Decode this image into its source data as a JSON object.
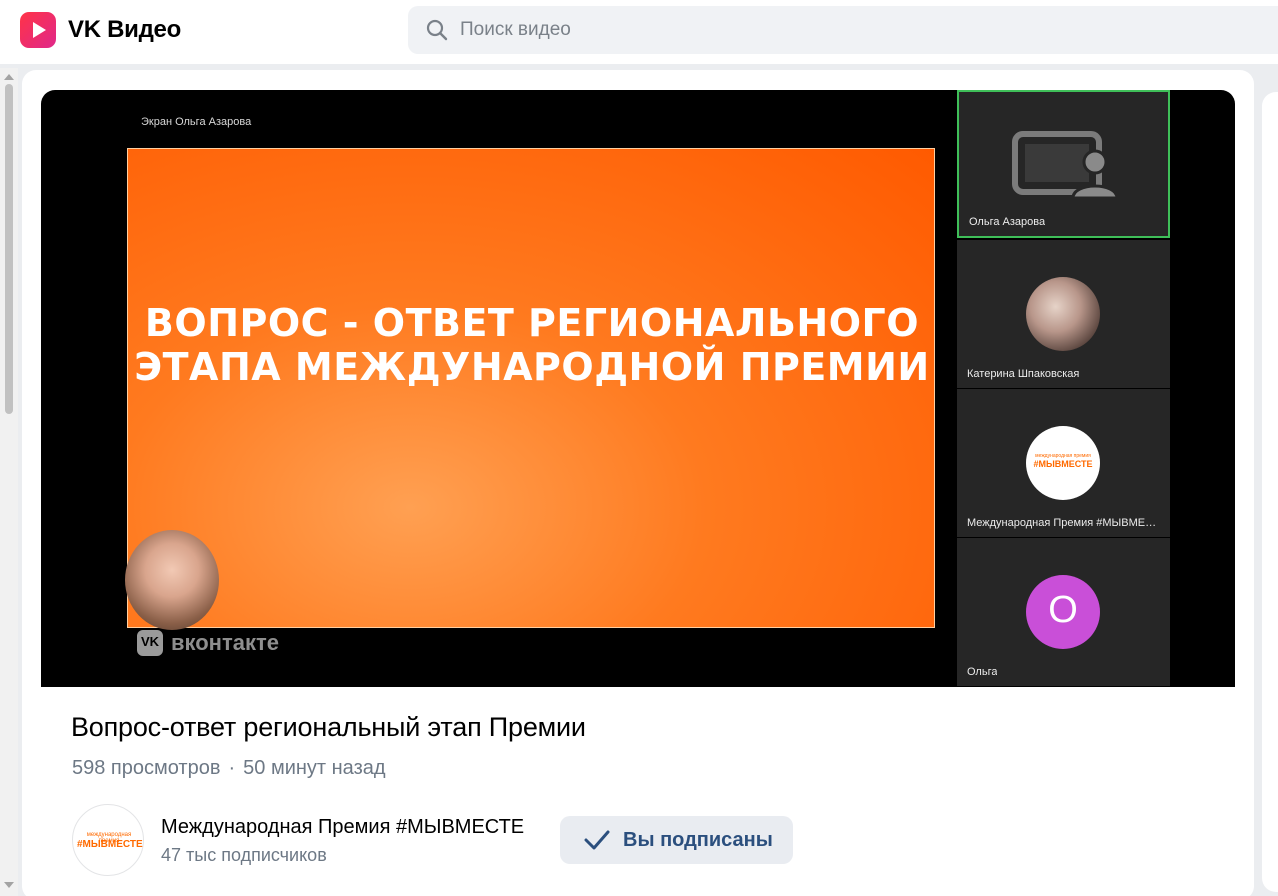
{
  "header": {
    "brand": "VK Видео",
    "search_placeholder": "Поиск видео"
  },
  "player": {
    "screen_label": "Экран Ольга Азарова",
    "slide_title": "ВОПРОС - ОТВЕТ РЕГИОНАЛЬНОГО ЭТАПА МЕЖДУНАРОДНОЙ ПРЕМИИ",
    "watermark": "вконтакте",
    "participants": [
      {
        "name": "Ольга Азарова",
        "type": "screen-share"
      },
      {
        "name": "Катерина Шпаковская",
        "type": "photo"
      },
      {
        "name": "Международная Премия #МЫВМЕСТЕ",
        "type": "logo"
      },
      {
        "name": "Ольга",
        "type": "initial",
        "initial": "О"
      }
    ]
  },
  "video": {
    "title": "Вопрос-ответ региональный этап Премии",
    "views": "598 просмотров",
    "separator": "·",
    "time_ago": "50 минут назад"
  },
  "channel": {
    "name": "Международная Премия #МЫВМЕСТЕ",
    "subscribers": "47 тыс подписчиков",
    "logo_small": "международная премия",
    "logo_big": "#МЫВМЕСТЕ",
    "subscribe_label": "Вы подписаны"
  },
  "colors": {
    "brand_gradient_start": "#ff3347",
    "slide_orange": "#ff5a00",
    "active_tile_border": "#3fbf59",
    "subscribe_text": "#2b4f7e",
    "initial_avatar": "#c94fd8"
  }
}
